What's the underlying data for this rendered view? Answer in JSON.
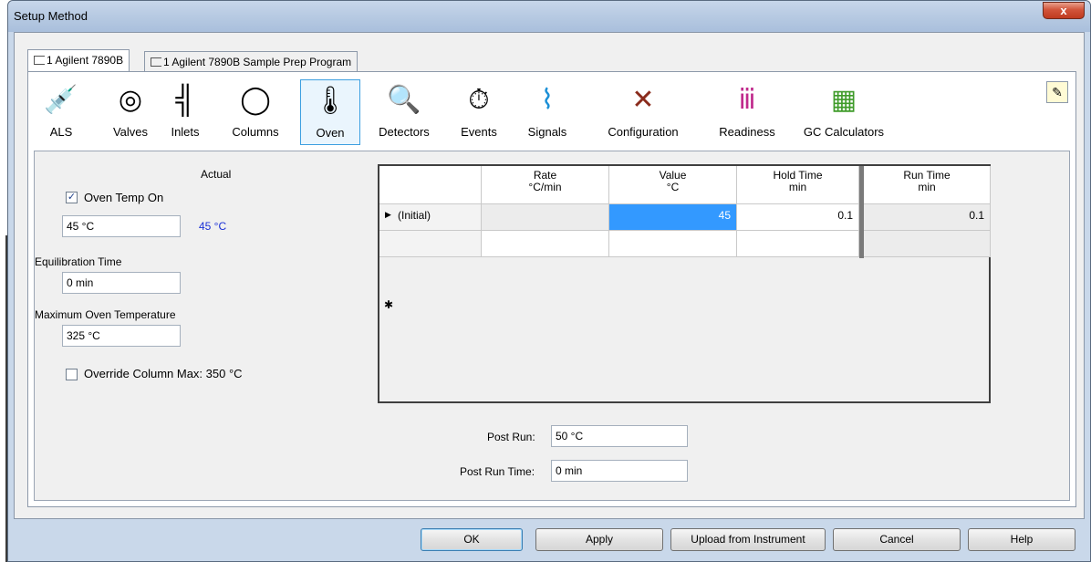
{
  "window": {
    "title": "Setup Method",
    "close_glyph": "x"
  },
  "tabs": [
    {
      "label": "1 Agilent 7890B",
      "active": true
    },
    {
      "label": "1 Agilent 7890B Sample Prep Program",
      "active": false
    }
  ],
  "toolbar": {
    "items": [
      {
        "label": "ALS",
        "icon": "syringe-icon",
        "glyph": "💉"
      },
      {
        "label": "Valves",
        "icon": "valve-icon",
        "glyph": "◎"
      },
      {
        "label": "Inlets",
        "icon": "inlet-icon",
        "glyph": "╣"
      },
      {
        "label": "Columns",
        "icon": "column-coil-icon",
        "glyph": "◯"
      },
      {
        "label": "Oven",
        "icon": "oven-thermometer-icon",
        "glyph": "🌡",
        "selected": true
      },
      {
        "label": "Detectors",
        "icon": "magnifier-detector-icon",
        "glyph": "🔍"
      },
      {
        "label": "Events",
        "icon": "stopwatch-icon",
        "glyph": "⏱"
      },
      {
        "label": "Signals",
        "icon": "signal-peaks-icon",
        "glyph": "⌇"
      },
      {
        "label": "Configuration",
        "icon": "tools-wrench-icon",
        "glyph": "✕"
      },
      {
        "label": "Readiness",
        "icon": "readiness-people-icon",
        "glyph": "ⅲ"
      },
      {
        "label": "GC Calculators",
        "icon": "calculator-icon",
        "glyph": "▦"
      }
    ],
    "notes_glyph": "✎"
  },
  "oven": {
    "actual_header": "Actual",
    "oven_temp_on_label": "Oven Temp On",
    "oven_temp_on_checked": true,
    "oven_temp_value": "45 °C",
    "actual_value": "45 °C",
    "equilibration_label": "Equilibration Time",
    "equilibration_value": "0 min",
    "max_temp_label": "Maximum Oven Temperature",
    "max_temp_value": "325 °C",
    "override_label": "Override Column Max: 350 °C",
    "override_checked": false,
    "check_glyph": "✓"
  },
  "ramp_table": {
    "headers": [
      {
        "line1": "Rate",
        "line2": "°C/min"
      },
      {
        "line1": "Value",
        "line2": "°C"
      },
      {
        "line1": "Hold Time",
        "line2": "min"
      },
      {
        "line1": "Run Time",
        "line2": "min"
      }
    ],
    "rows": [
      {
        "marker": "▶",
        "label": "(Initial)",
        "rate": "",
        "value": "45",
        "hold": "0.1",
        "run": "0.1"
      },
      {
        "marker": "✱",
        "label": "",
        "rate": "",
        "value": "",
        "hold": "",
        "run": ""
      }
    ]
  },
  "post_run": {
    "post_run_label": "Post Run:",
    "post_run_value": "50 °C",
    "post_run_time_label": "Post Run Time:",
    "post_run_time_value": "0 min"
  },
  "buttons": {
    "ok": "OK",
    "apply": "Apply",
    "upload": "Upload from Instrument",
    "cancel": "Cancel",
    "help": "Help"
  },
  "colors": {
    "selection": "#3399ff",
    "actual_text": "#1a2fd6"
  }
}
